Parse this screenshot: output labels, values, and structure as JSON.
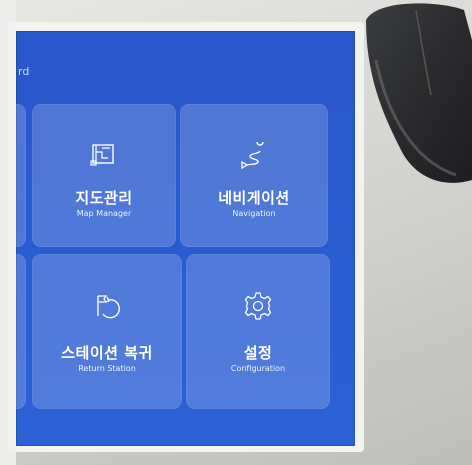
{
  "header": {
    "title_fragment": "rd"
  },
  "tiles": [
    {
      "ko": "지도관리",
      "en": "Map Manager",
      "icon": "map-icon"
    },
    {
      "ko": "네비게이션",
      "en": "Navigation",
      "icon": "route-icon"
    },
    {
      "ko": "스테이션 복귀",
      "en": "Return Station",
      "icon": "flag-return-icon"
    },
    {
      "ko": "설정",
      "en": "Configuration",
      "icon": "gear-icon"
    }
  ],
  "colors": {
    "screen_background": "#2a5bd0",
    "tile_background": "rgba(255,255,255,0.18)",
    "text": "#ffffff"
  }
}
